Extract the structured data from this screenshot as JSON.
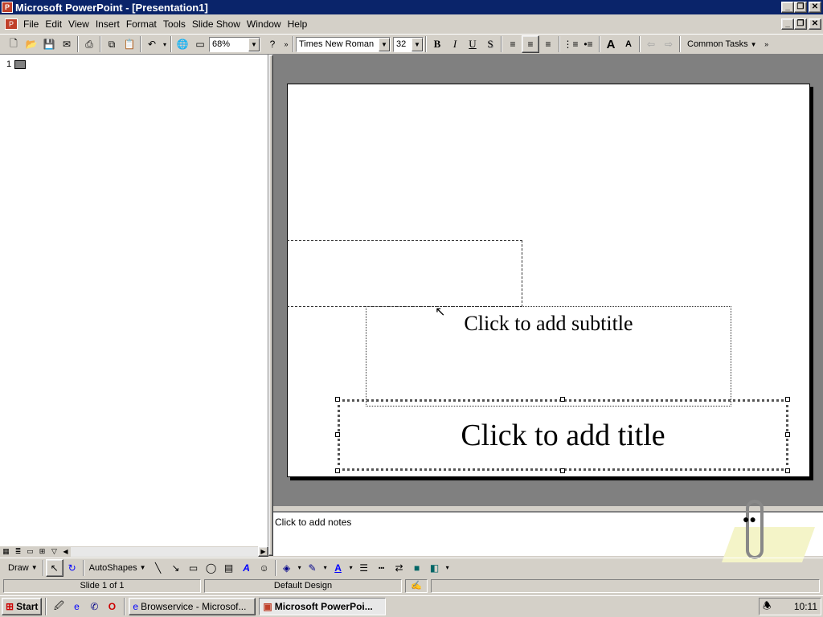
{
  "window": {
    "title": "Microsoft PowerPoint - [Presentation1]"
  },
  "menu": {
    "items": [
      "File",
      "Edit",
      "View",
      "Insert",
      "Format",
      "Tools",
      "Slide Show",
      "Window",
      "Help"
    ]
  },
  "toolbar": {
    "zoom": "68%",
    "font": "Times New Roman",
    "font_size": "32",
    "bold": "B",
    "italic": "I",
    "underline": "U",
    "shadow": "S",
    "common_tasks": "Common Tasks"
  },
  "outline": {
    "slide_number": "1"
  },
  "slide": {
    "subtitle_placeholder": "Click to add subtitle",
    "title_placeholder": "Click to add title"
  },
  "notes": {
    "placeholder": "Click to add notes"
  },
  "drawing": {
    "draw_label": "Draw",
    "autoshapes_label": "AutoShapes"
  },
  "status": {
    "slide_position": "Slide 1 of 1",
    "design": "Default Design"
  },
  "taskbar": {
    "start_label": "Start",
    "tasks": [
      "Browservice - Microsof...",
      "Microsoft PowerPoi..."
    ],
    "clock": "10:11"
  },
  "colors": {
    "titlebar": "#0a246a",
    "chrome": "#d4d0c8",
    "slide_area": "#808080"
  }
}
